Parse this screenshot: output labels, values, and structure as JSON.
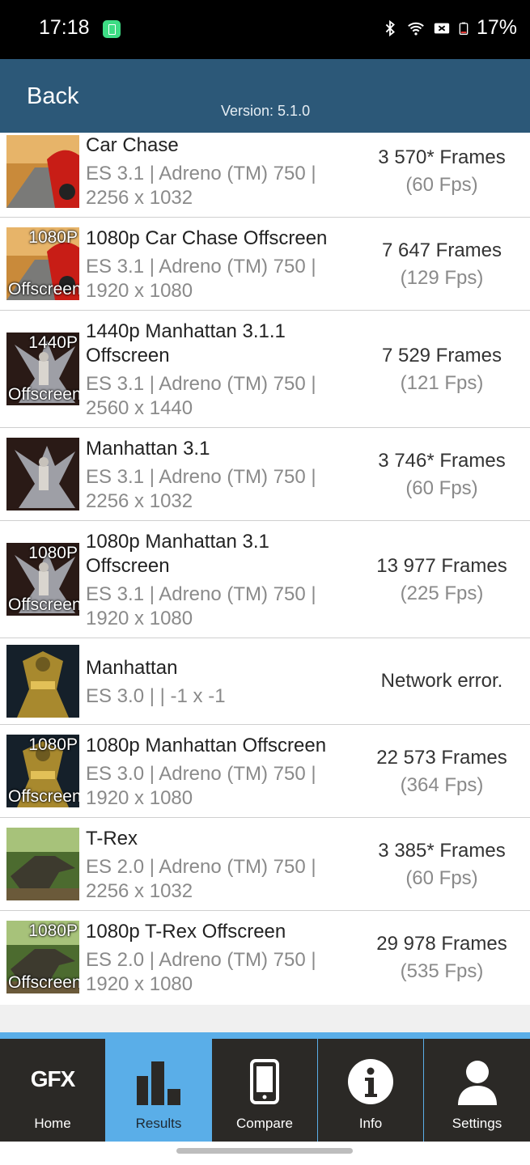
{
  "status_bar": {
    "time": "17:18",
    "battery": "17%"
  },
  "header": {
    "back": "Back",
    "version": "Version: 5.1.0"
  },
  "results": [
    {
      "title": "Car Chase",
      "subtitle": "ES 3.1 | Adreno (TM) 750 | 2256 x 1032",
      "score": "3 570* Frames",
      "fps": "(60 Fps)",
      "badge_top": "",
      "badge_bottom": "",
      "thumb": "car-chase"
    },
    {
      "title": "1080p Car Chase Offscreen",
      "subtitle": "ES 3.1 | Adreno (TM) 750 | 1920 x 1080",
      "score": "7 647 Frames",
      "fps": "(129 Fps)",
      "badge_top": "1080P",
      "badge_bottom": "Offscreen",
      "thumb": "car-chase"
    },
    {
      "title": "1440p Manhattan 3.1.1 Offscreen",
      "subtitle": "ES 3.1 | Adreno (TM) 750 | 2560 x 1440",
      "score": "7 529 Frames",
      "fps": "(121 Fps)",
      "badge_top": "1440P",
      "badge_bottom": "Offscreen",
      "thumb": "manhattan31"
    },
    {
      "title": "Manhattan 3.1",
      "subtitle": "ES 3.1 | Adreno (TM) 750 | 2256 x 1032",
      "score": "3 746* Frames",
      "fps": "(60 Fps)",
      "badge_top": "",
      "badge_bottom": "",
      "thumb": "manhattan31"
    },
    {
      "title": "1080p Manhattan 3.1 Offscreen",
      "subtitle": "ES 3.1 | Adreno (TM) 750 | 1920 x 1080",
      "score": "13 977 Frames",
      "fps": "(225 Fps)",
      "badge_top": "1080P",
      "badge_bottom": "Offscreen",
      "thumb": "manhattan31"
    },
    {
      "title": "Manhattan",
      "subtitle": "ES 3.0 |  | -1 x -1",
      "score": "Network error.",
      "fps": "",
      "badge_top": "",
      "badge_bottom": "",
      "thumb": "manhattan"
    },
    {
      "title": "1080p Manhattan Offscreen",
      "subtitle": "ES 3.0 | Adreno (TM) 750 | 1920 x 1080",
      "score": "22 573 Frames",
      "fps": "(364 Fps)",
      "badge_top": "1080P",
      "badge_bottom": "Offscreen",
      "thumb": "manhattan"
    },
    {
      "title": "T-Rex",
      "subtitle": "ES 2.0 | Adreno (TM) 750 | 2256 x 1032",
      "score": "3 385* Frames",
      "fps": "(60 Fps)",
      "badge_top": "",
      "badge_bottom": "",
      "thumb": "trex"
    },
    {
      "title": "1080p T-Rex Offscreen",
      "subtitle": "ES 2.0 | Adreno (TM) 750 | 1920 x 1080",
      "score": "29 978 Frames",
      "fps": "(535 Fps)",
      "badge_top": "1080P",
      "badge_bottom": "Offscreen",
      "thumb": "trex"
    }
  ],
  "tabs": [
    {
      "label": "Home",
      "icon": "gfx-logo-icon",
      "logo_text": "GFX",
      "active": false
    },
    {
      "label": "Results",
      "icon": "bar-chart-icon",
      "active": true
    },
    {
      "label": "Compare",
      "icon": "phone-icon",
      "active": false
    },
    {
      "label": "Info",
      "icon": "info-icon",
      "active": false
    },
    {
      "label": "Settings",
      "icon": "user-icon",
      "active": false
    }
  ],
  "colors": {
    "header": "#2c5878",
    "tab_active": "#5aaee8",
    "tab_bg": "#2b2926"
  }
}
